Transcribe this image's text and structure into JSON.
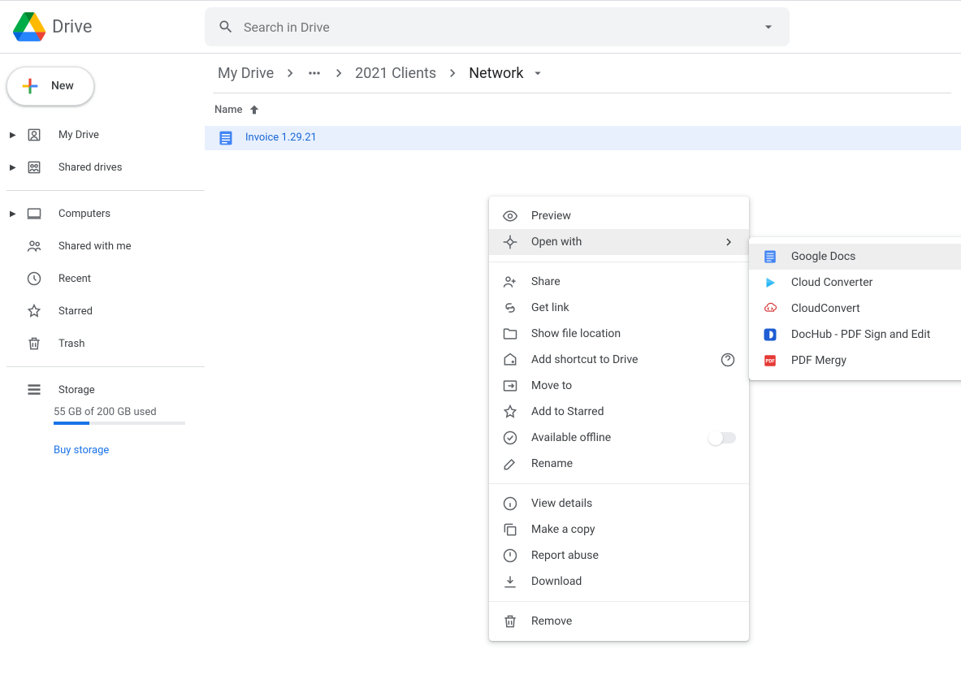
{
  "header": {
    "title": "Drive",
    "search_placeholder": "Search in Drive"
  },
  "sidebar": {
    "new_label": "New",
    "items": [
      {
        "label": "My Drive",
        "expandable": true,
        "icon": "my-drive"
      },
      {
        "label": "Shared drives",
        "expandable": true,
        "icon": "shared-drives"
      }
    ],
    "items2": [
      {
        "label": "Computers",
        "expandable": true,
        "icon": "computers"
      }
    ],
    "items3": [
      {
        "label": "Shared with me",
        "expandable": false,
        "icon": "shared"
      },
      {
        "label": "Recent",
        "expandable": false,
        "icon": "recent"
      },
      {
        "label": "Starred",
        "expandable": false,
        "icon": "starred"
      },
      {
        "label": "Trash",
        "expandable": false,
        "icon": "trash"
      }
    ],
    "storage_label": "Storage",
    "storage_text": "55 GB of 200 GB used",
    "buy_storage": "Buy storage"
  },
  "breadcrumb": {
    "items": [
      "My Drive",
      "…",
      "2021 Clients",
      "Network"
    ]
  },
  "columns": {
    "name": "Name"
  },
  "files": [
    {
      "name": "Invoice 1.29.21",
      "type": "doc"
    }
  ],
  "context_menu": {
    "preview": "Preview",
    "open_with": "Open with",
    "share": "Share",
    "get_link": "Get link",
    "show_location": "Show file location",
    "add_shortcut": "Add shortcut to Drive",
    "move_to": "Move to",
    "add_starred": "Add to Starred",
    "available_offline": "Available offline",
    "rename": "Rename",
    "view_details": "View details",
    "make_copy": "Make a copy",
    "report_abuse": "Report abuse",
    "download": "Download",
    "remove": "Remove"
  },
  "submenu": {
    "items": [
      {
        "label": "Google Docs",
        "icon": "docs"
      },
      {
        "label": "Cloud Converter",
        "icon": "cloud-converter"
      },
      {
        "label": "CloudConvert",
        "icon": "cloudconvert"
      },
      {
        "label": "DocHub - PDF Sign and Edit",
        "icon": "dochub"
      },
      {
        "label": "PDF Mergy",
        "icon": "pdfmergy"
      }
    ]
  }
}
